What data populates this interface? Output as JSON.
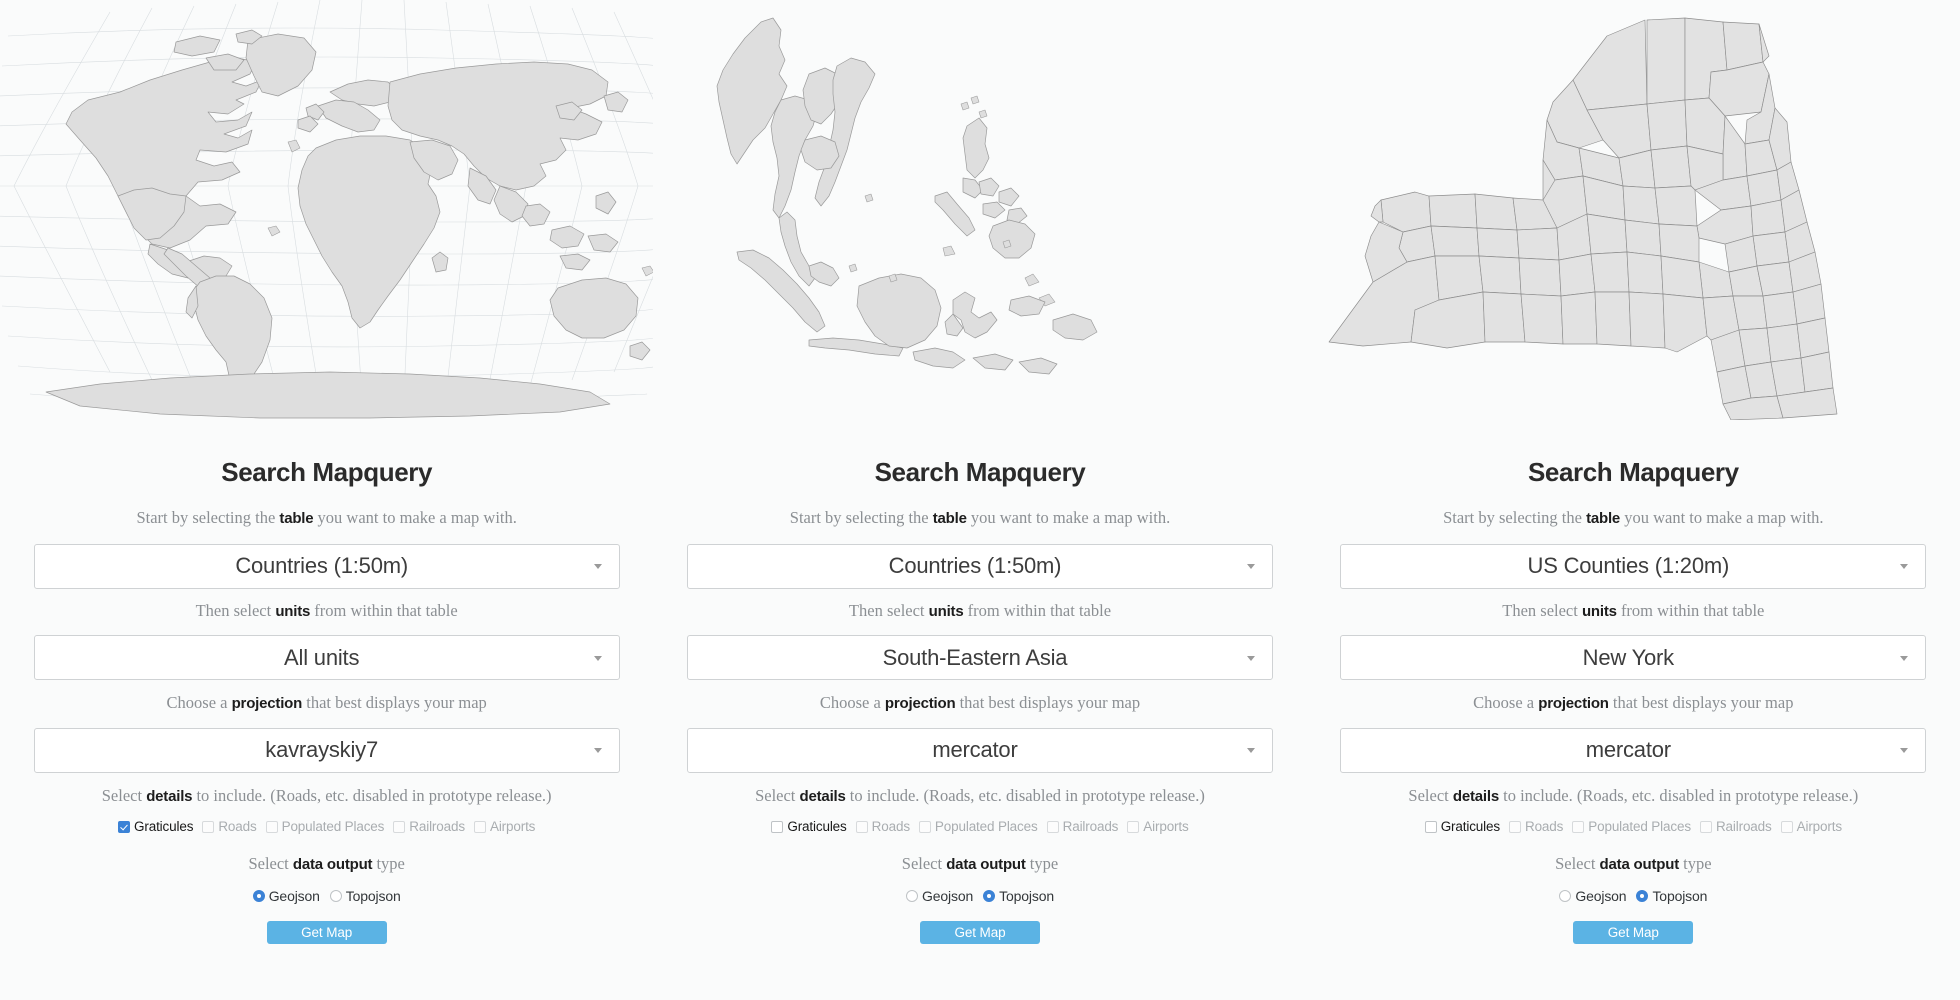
{
  "theme": {
    "background": "#fafbfb",
    "accent_button": "#5bb3e4",
    "accent_control": "#3b82d6",
    "land_fill": "#dedede",
    "land_stroke": "#9a9a9a",
    "graticule_stroke": "#d8dde0",
    "text_dark": "#1d1d1d",
    "text_muted": "#8b8f93",
    "text_disabled": "#a9adb0",
    "select_border": "#cfd2d4"
  },
  "labels": {
    "title": "Search Mapquery",
    "help_table_pre": "Start by selecting the ",
    "help_table_bold": "table",
    "help_table_post": " you want to make a map with.",
    "help_units_pre": "Then select ",
    "help_units_bold": "units",
    "help_units_post": " from within that table",
    "help_projection_pre": "Choose a ",
    "help_projection_bold": "projection",
    "help_projection_post": " that best displays your map",
    "help_details_pre": "Select ",
    "help_details_bold": "details",
    "help_details_post": " to include. (Roads, etc. disabled in prototype release.)",
    "help_output_pre": "Select ",
    "help_output_bold": "data output",
    "help_output_post": " type",
    "get_map": "Get Map",
    "arrow_icon": "chevron-down-icon"
  },
  "detail_options": [
    {
      "label": "Graticules",
      "disabled": false
    },
    {
      "label": "Roads",
      "disabled": true
    },
    {
      "label": "Populated Places",
      "disabled": true
    },
    {
      "label": "Railroads",
      "disabled": true
    },
    {
      "label": "Airports",
      "disabled": true
    }
  ],
  "output_options": [
    "Geojson",
    "Topojson"
  ],
  "panels": [
    {
      "id": "panel-world",
      "map": {
        "name": "world-map-kavrayskiy7",
        "region": "World",
        "projection": "kavrayskiy7",
        "graticule": true
      },
      "table_select": {
        "value": "Countries (1:50m)"
      },
      "units_select": {
        "value": "All units"
      },
      "projection_select": {
        "value": "kavrayskiy7"
      },
      "details": {
        "Graticules": true,
        "Roads": false,
        "Populated Places": false,
        "Railroads": false,
        "Airports": false
      },
      "output": "Geojson"
    },
    {
      "id": "panel-sea",
      "map": {
        "name": "south-eastern-asia-map-mercator",
        "region": "South-Eastern Asia",
        "projection": "mercator",
        "graticule": false
      },
      "table_select": {
        "value": "Countries (1:50m)"
      },
      "units_select": {
        "value": "South-Eastern Asia"
      },
      "projection_select": {
        "value": "mercator"
      },
      "details": {
        "Graticules": false,
        "Roads": false,
        "Populated Places": false,
        "Railroads": false,
        "Airports": false
      },
      "output": "Topojson"
    },
    {
      "id": "panel-ny",
      "map": {
        "name": "new-york-counties-map-mercator",
        "region": "New York",
        "projection": "mercator",
        "graticule": false
      },
      "table_select": {
        "value": "US Counties (1:20m)"
      },
      "units_select": {
        "value": "New York"
      },
      "projection_select": {
        "value": "mercator"
      },
      "details": {
        "Graticules": false,
        "Roads": false,
        "Populated Places": false,
        "Railroads": false,
        "Airports": false
      },
      "output": "Topojson"
    }
  ]
}
